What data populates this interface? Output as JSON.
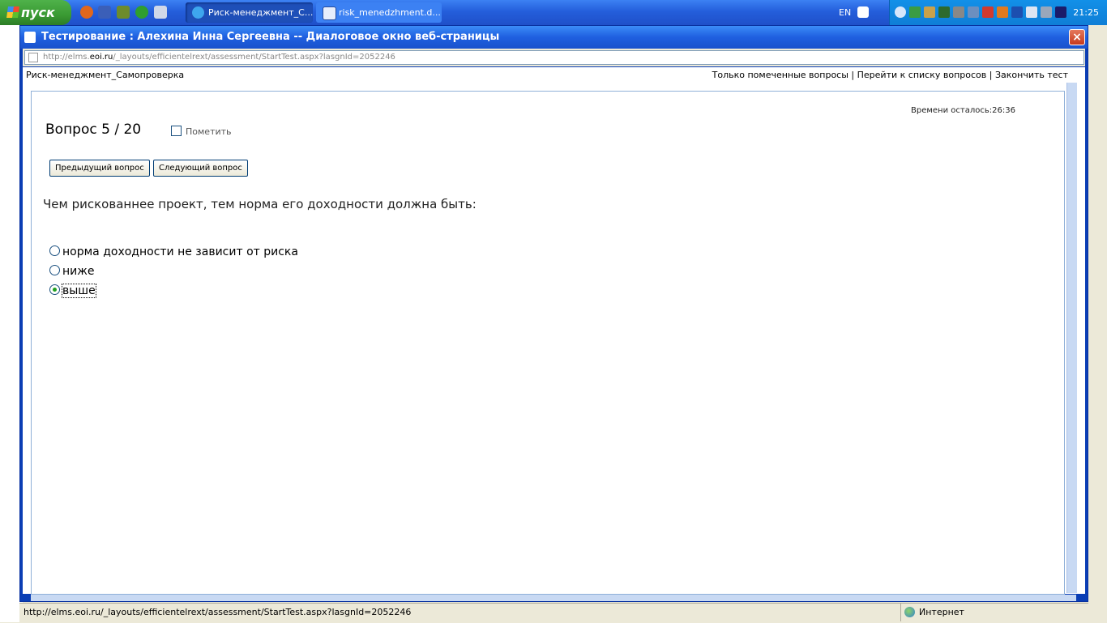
{
  "taskbar": {
    "start_label": "пуск",
    "windows": [
      {
        "label": "Риск-менеджмент_С..."
      },
      {
        "label": "risk_menedzhment.d..."
      }
    ],
    "lang": "EN",
    "clock": "21:25"
  },
  "dialog": {
    "title": "Тестирование : Алехина Инна Сергеевна -- Диалоговое окно веб-страницы",
    "close_label": "×",
    "address_prefix": "http://elms.",
    "address_domain": "eoi.ru",
    "address_suffix": "/_layouts/efficientelrext/assessment/StartTest.aspx?lasgnId=2052246"
  },
  "header": {
    "course": "Риск-менеджмент_Самопроверка",
    "link_marked": "Только помеченные вопросы",
    "link_list": "Перейти к списку вопросов",
    "link_finish": "Закончить тест",
    "separator": "|"
  },
  "test": {
    "timer": "Времени осталось:26:36",
    "question_number": "Вопрос 5 / 20",
    "mark_label": "Пометить",
    "prev_button": "Предыдущий вопрос",
    "next_button": "Следующий вопрос",
    "question_text": "Чем рискованнее проект, тем норма его доходности должна быть:",
    "options": [
      {
        "label": "норма доходности не зависит от риска",
        "selected": false
      },
      {
        "label": "ниже",
        "selected": false
      },
      {
        "label": "выше",
        "selected": true
      }
    ]
  },
  "status": {
    "url": "http://elms.eoi.ru/_layouts/efficientelrext/assessment/StartTest.aspx?lasgnId=2052246",
    "zone": "Интернет"
  }
}
